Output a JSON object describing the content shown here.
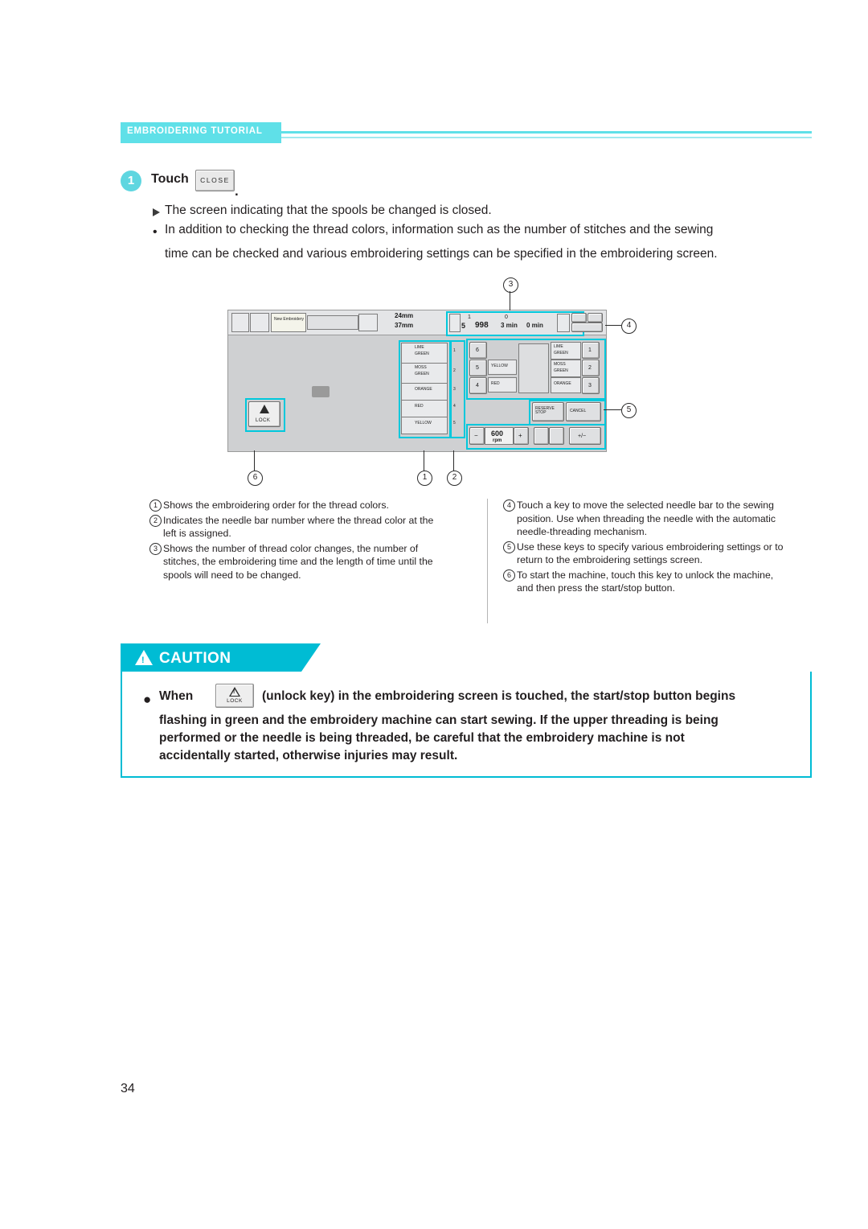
{
  "header": {
    "title": "EMBROIDERING TUTORIAL"
  },
  "step": {
    "number": "1",
    "label": "Touch",
    "key_label": "CLOSE",
    "period": ".",
    "bullet_arrow": "The screen indicating that the spools be changed is closed.",
    "bullet_dot": "•",
    "bullet_line1": "In addition to checking the thread colors, information such as the number of stitches and the sewing",
    "bullet_line2": "time can be checked and various embroidering settings can be specified in the embroidering screen."
  },
  "figure": {
    "callouts": [
      "1",
      "2",
      "3",
      "4",
      "5",
      "6"
    ],
    "top_bar": {
      "size_w": "24mm",
      "size_h": "37mm",
      "new_embroidery": "New Embroidery",
      "counter_changes": "1",
      "counter_changes_sub": "0",
      "stitches": "998",
      "time_total": "3 min",
      "time_remaining": "0 min",
      "stitch_field_small": "5"
    },
    "thread_list": [
      {
        "order": "1",
        "name_line1": "LIME",
        "name_line2": "GREEN"
      },
      {
        "order": "2",
        "name_line1": "MOSS",
        "name_line2": "GREEN"
      },
      {
        "order": "3",
        "name_line1": "ORANGE",
        "name_line2": ""
      },
      {
        "order": "4",
        "name_line1": "RED",
        "name_line2": ""
      },
      {
        "order": "5",
        "name_line1": "YELLOW",
        "name_line2": ""
      }
    ],
    "needle_left": [
      {
        "bar": "6",
        "color": ""
      },
      {
        "bar": "5",
        "color": "YELLOW"
      },
      {
        "bar": "4",
        "color": "RED"
      }
    ],
    "needle_right": [
      {
        "bar": "1",
        "color_line1": "LIME",
        "color_line2": "GREEN"
      },
      {
        "bar": "2",
        "color_line1": "MOSS",
        "color_line2": "GREEN"
      },
      {
        "bar": "3",
        "color_line1": "ORANGE",
        "color_line2": ""
      }
    ],
    "buttons": {
      "reserve_stop": "RESERVE STOP",
      "cancel": "CANCEL",
      "speed_value": "600",
      "speed_unit": "rpm",
      "minus": "−",
      "plus": "+",
      "plus_minus": "+/−",
      "lock": "LOCK"
    }
  },
  "legend": {
    "left": [
      {
        "mark": "1",
        "text": "Shows the embroidering order for the thread colors."
      },
      {
        "mark": "2",
        "text": "Indicates the needle bar number where the thread color at the left is assigned."
      },
      {
        "mark": "3",
        "text": "Shows the number of thread color changes, the number of stitches, the embroidering time and the length of time until the spools will need to be changed."
      }
    ],
    "right": [
      {
        "mark": "4",
        "text": "Touch a key to move the selected needle bar to the sewing position. Use when threading the needle with the automatic needle-threading mechanism."
      },
      {
        "mark": "5",
        "text": "Use these keys to specify various embroidering settings or to return to the embroidering settings screen."
      },
      {
        "mark": "6",
        "text": "To start the machine, touch this key to unlock the machine, and then press the start/stop button."
      }
    ]
  },
  "caution": {
    "title": "CAUTION",
    "bullet": "●",
    "when": "When",
    "key_label": "LOCK",
    "line1": "(unlock key) in the embroidering screen is touched, the start/stop button begins",
    "line2": "flashing in green and the embroidery machine can start sewing. If the upper threading is being",
    "line3": "performed or the needle is being threaded, be careful that the embroidery machine is not",
    "line4": "accidentally started, otherwise injuries may result."
  },
  "page_number": "34"
}
